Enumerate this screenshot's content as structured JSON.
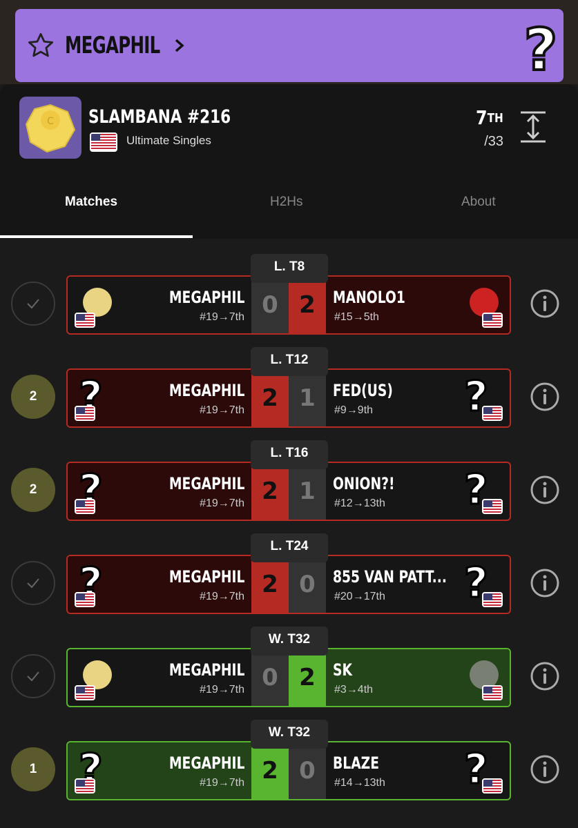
{
  "banner": {
    "player_name": "MEGAPHIL"
  },
  "tournament": {
    "name": "SLAMBANA #216",
    "event": "Ultimate Singles",
    "placement": "7",
    "placement_suffix": "TH",
    "entrants": "/33"
  },
  "tabs": [
    {
      "label": "Matches"
    },
    {
      "label": "H2Hs"
    },
    {
      "label": "About"
    }
  ],
  "matches": [
    {
      "round": "L. T8",
      "left_status": "check",
      "left_status_text": "",
      "winner": "right",
      "color": "red",
      "p1": {
        "name": "MEGAPHIL",
        "seed": "#19→7th",
        "score": "0",
        "character": "link-icon"
      },
      "p2": {
        "name": "MANOLO1",
        "seed": "#15→5th",
        "score": "2",
        "character": "mario-icon"
      }
    },
    {
      "round": "L. T12",
      "left_status": "score",
      "left_status_text": "2",
      "winner": "left",
      "color": "red",
      "p1": {
        "name": "MEGAPHIL",
        "seed": "#19→7th",
        "score": "2",
        "character": "unknown-icon"
      },
      "p2": {
        "name": "FED(US)",
        "seed": "#9→9th",
        "score": "1",
        "character": "unknown-icon"
      }
    },
    {
      "round": "L. T16",
      "left_status": "score",
      "left_status_text": "2",
      "winner": "left",
      "color": "red",
      "p1": {
        "name": "MEGAPHIL",
        "seed": "#19→7th",
        "score": "2",
        "character": "unknown-icon"
      },
      "p2": {
        "name": "ONION?!",
        "seed": "#12→13th",
        "score": "1",
        "character": "unknown-icon"
      }
    },
    {
      "round": "L. T24",
      "left_status": "check",
      "left_status_text": "",
      "winner": "left",
      "color": "red",
      "p1": {
        "name": "MEGAPHIL",
        "seed": "#19→7th",
        "score": "2",
        "character": "luigi-icon"
      },
      "p2": {
        "name": "855 VAN PATT...",
        "seed": "#20→17th",
        "score": "0",
        "character": "dr-mario-icon"
      }
    },
    {
      "round": "W. T32",
      "left_status": "check",
      "left_status_text": "",
      "winner": "right",
      "color": "green",
      "p1": {
        "name": "MEGAPHIL",
        "seed": "#19→7th",
        "score": "0",
        "character": "link-icon"
      },
      "p2": {
        "name": "SK",
        "seed": "#3→4th",
        "score": "2",
        "character": "snake-icon"
      }
    },
    {
      "round": "W. T32",
      "left_status": "score",
      "left_status_text": "1",
      "winner": "left",
      "color": "green",
      "p1": {
        "name": "MEGAPHIL",
        "seed": "#19→7th",
        "score": "2",
        "character": "falco-icon"
      },
      "p2": {
        "name": "BLAZE",
        "seed": "#14→13th",
        "score": "0",
        "character": "dr-mario-icon"
      }
    }
  ]
}
